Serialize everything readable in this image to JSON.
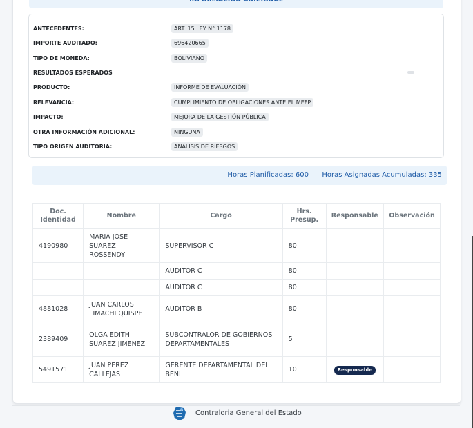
{
  "section_title": "INFORMACIÓN ADICIONAL",
  "info": [
    {
      "label": "ANTECEDENTES:",
      "value": "ART. 15 LEY N° 1178"
    },
    {
      "label": "IMPORTE AUDITADO:",
      "value": "696420665"
    },
    {
      "label": "TIPO DE MONEDA:",
      "value": "BOLIVIANO"
    },
    {
      "label": "RESULTADOS ESPERADOS",
      "value": ""
    },
    {
      "label": "PRODUCTO:",
      "value": "INFORME DE EVALUACIÓN"
    },
    {
      "label": "RELEVANCIA:",
      "value": "CUMPLIMIENTO DE OBLIGACIONES ANTE EL MEFP"
    },
    {
      "label": "IMPACTO:",
      "value": "MEJORA DE LA GESTIÓN PÚBLICA"
    },
    {
      "label": "OTRA INFORMACIÓN ADICIONAL:",
      "value": "NINGUNA"
    },
    {
      "label": "TIPO ORIGEN AUDITORIA:",
      "value": "ANÁLISIS DE RIESGOS"
    }
  ],
  "hours": {
    "planned": "Horas Planificadas: 600",
    "assigned": "Horas Asignadas Acumuladas: 335"
  },
  "table": {
    "headers": [
      "Doc. Identidad",
      "Nombre",
      "Cargo",
      "Hrs. Presup.",
      "Responsable",
      "Observación"
    ],
    "rows": [
      {
        "doc": "4190980",
        "name": "MARIA JOSE SUAREZ ROSSENDY",
        "cargo": "SUPERVISOR C",
        "hrs": "80",
        "resp": "",
        "obs": ""
      },
      {
        "doc": "",
        "name": "",
        "cargo": "AUDITOR C",
        "hrs": "80",
        "resp": "",
        "obs": ""
      },
      {
        "doc": "",
        "name": "",
        "cargo": "AUDITOR C",
        "hrs": "80",
        "resp": "",
        "obs": ""
      },
      {
        "doc": "4881028",
        "name": "JUAN CARLOS LIMACHI QUISPE",
        "cargo": "AUDITOR B",
        "hrs": "80",
        "resp": "",
        "obs": ""
      },
      {
        "doc": "2389409",
        "name": "OLGA EDITH SUAREZ JIMENEZ",
        "cargo": "SUBCONTRALOR DE GOBIERNOS DEPARTAMENTALES",
        "hrs": "5",
        "resp": "",
        "obs": ""
      },
      {
        "doc": "5491571",
        "name": "JUAN PEREZ CALLEJAS",
        "cargo": "GERENTE DEPARTAMENTAL DEL BENI",
        "hrs": "10",
        "resp": "Responsable",
        "obs": ""
      }
    ]
  },
  "footer": {
    "text": "Contraloria General del Estado",
    "logo_icon": "cge-logo-icon"
  },
  "colors": {
    "accent": "#1d5aa6",
    "badge": "#15294f",
    "header_bg": "#eaf3fb"
  }
}
